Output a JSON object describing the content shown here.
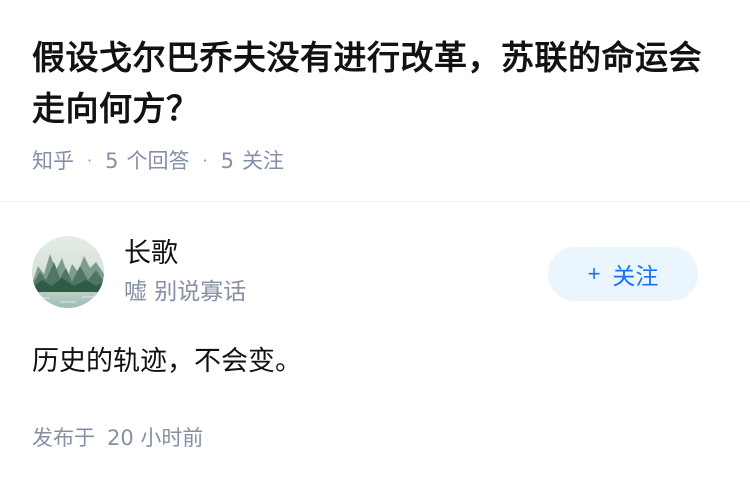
{
  "question": {
    "title": "假设戈尔巴乔夫没有进行改革，苏联的命运会走向何方？",
    "source": "知乎",
    "answer_count": "5",
    "answer_label": "个回答",
    "follow_count": "5",
    "follow_label": "关注"
  },
  "answer": {
    "author": {
      "name": "长歌",
      "bio": "嘘 别说寡话",
      "avatar_icon": "landscape-avatar"
    },
    "follow_button": {
      "icon": "+",
      "label": "关注"
    },
    "content": "历史的轨迹，不会变。",
    "time_prefix": "发布于",
    "time_value": "20 小时前"
  },
  "colors": {
    "primary_text": "#121212",
    "secondary_text": "#8590a6",
    "accent": "#1772f6",
    "follow_bg": "#ebf5fd"
  }
}
